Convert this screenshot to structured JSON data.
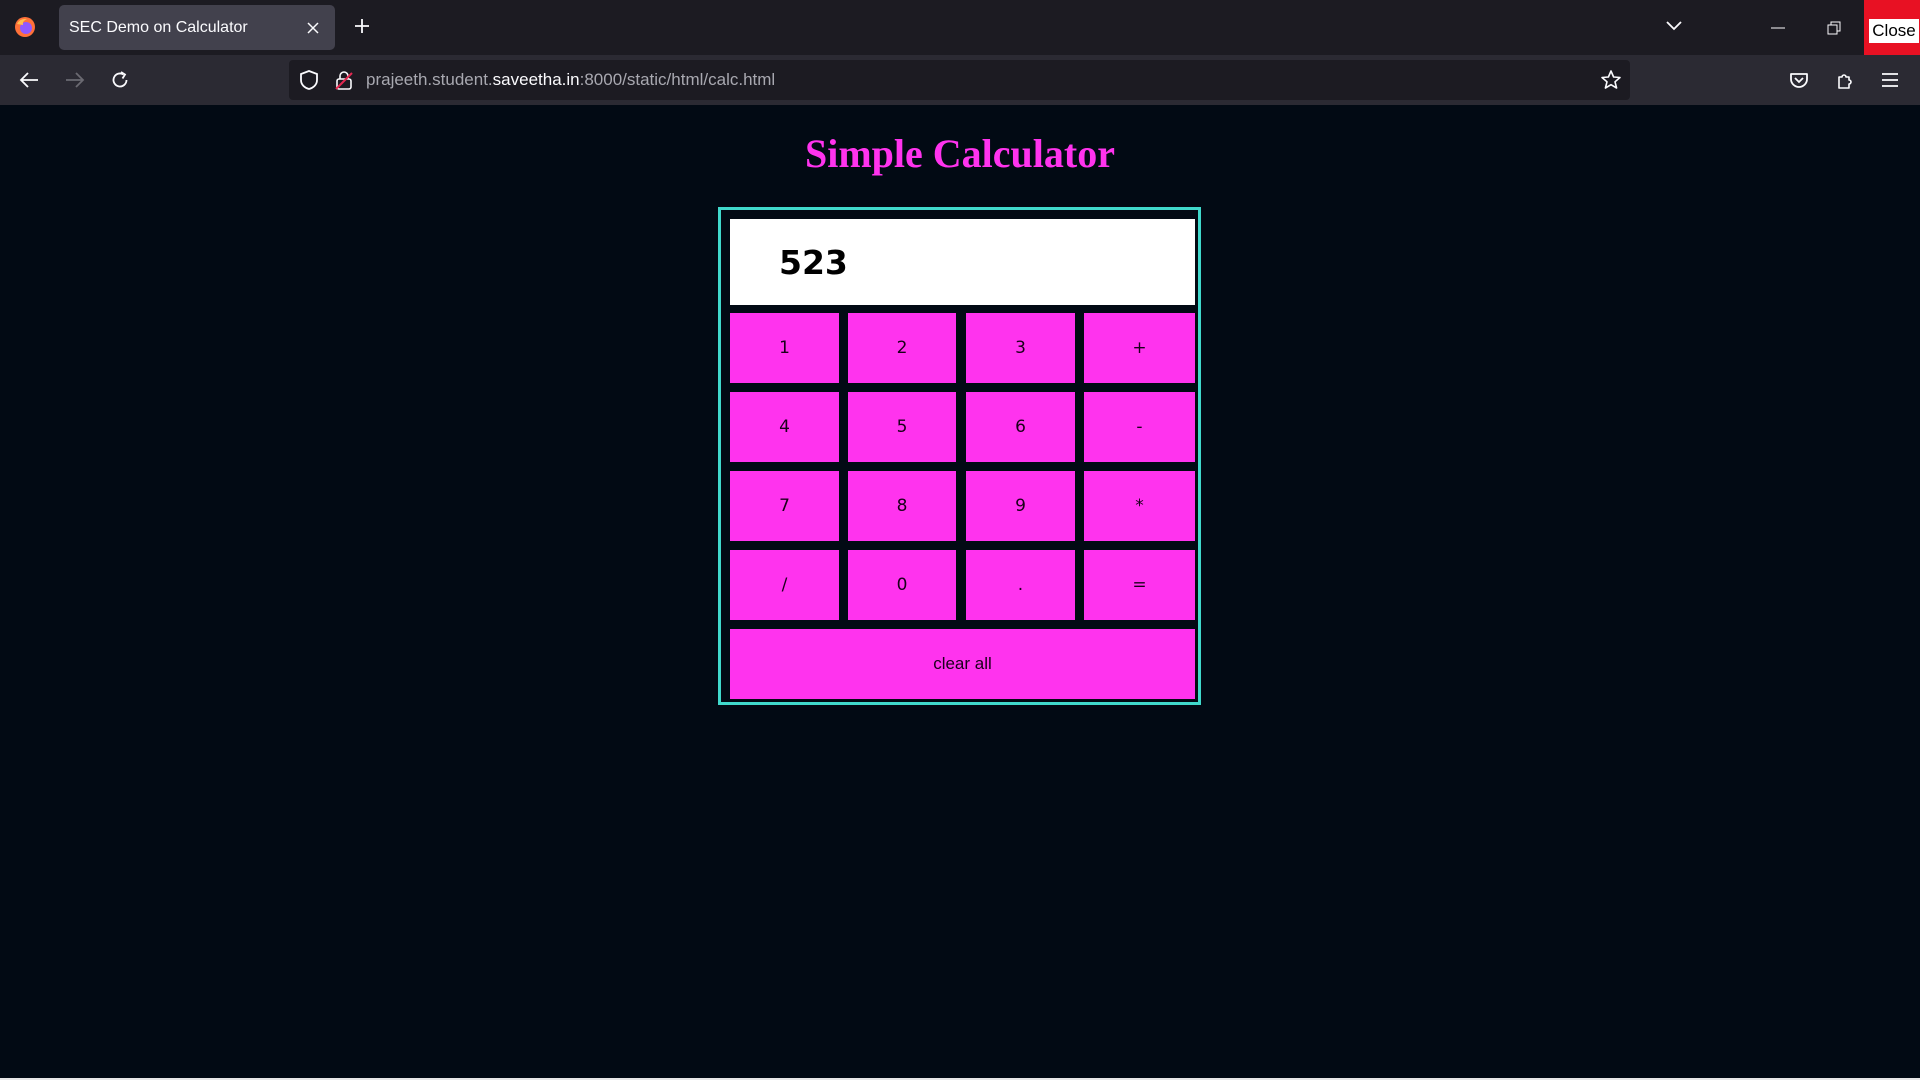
{
  "browser": {
    "tab_title": "SEC Demo on Calculator",
    "url_prefix": "prajeeth.student.",
    "url_domain": "saveetha.in",
    "url_suffix": ":8000/static/html/calc.html",
    "close_label": "Close"
  },
  "page": {
    "title": "Simple Calculator",
    "display_value": "523",
    "keys": {
      "k1": "1",
      "k2": "2",
      "k3": "3",
      "plus": "+",
      "k4": "4",
      "k5": "5",
      "k6": "6",
      "minus": "-",
      "k7": "7",
      "k8": "8",
      "k9": "9",
      "multiply": "*",
      "divide": "/",
      "k0": "0",
      "dot": ".",
      "equals": "=",
      "clear": "clear all"
    }
  },
  "colors": {
    "page_bg": "#020a14",
    "accent": "#ff33ee",
    "border": "#40d9cc",
    "close_button": "#e81123"
  }
}
